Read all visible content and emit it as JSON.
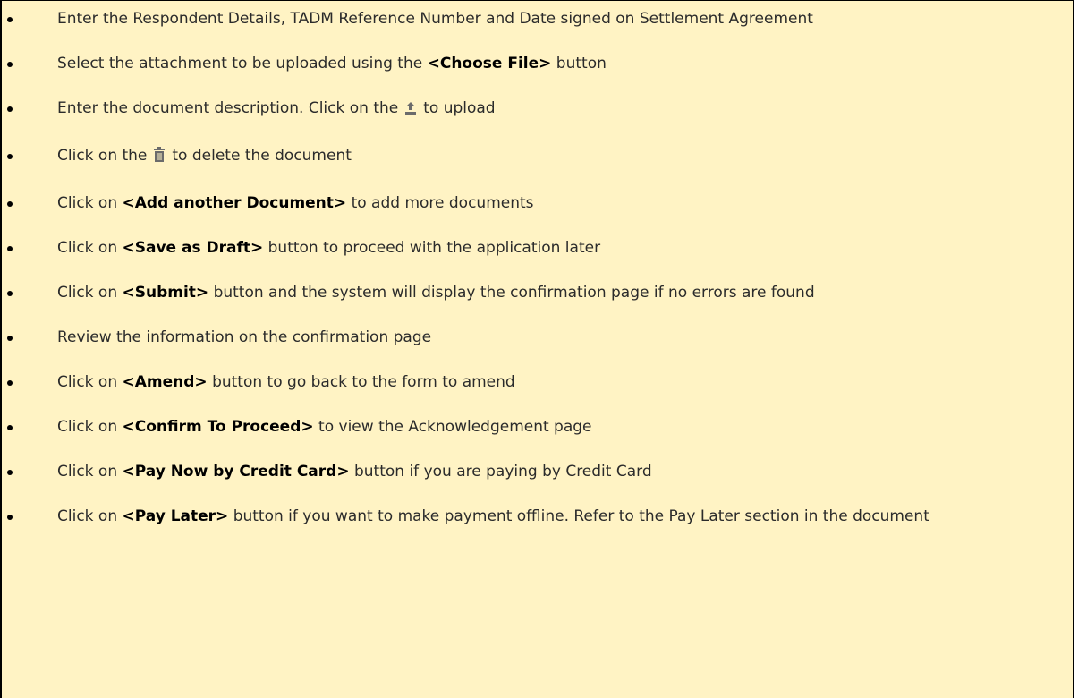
{
  "steps": [
    {
      "pre": "Enter the Respondent Details, TADM Reference Number and Date signed on Settlement Agreement",
      "bold": "",
      "post": ""
    },
    {
      "pre": "Select the attachment to be uploaded using the ",
      "bold": "<Choose File>",
      "post": " button"
    },
    {
      "pre": "Enter the document description. Click on the",
      "icon": "upload-icon",
      "post": "to upload"
    },
    {
      "pre": "Click on the",
      "icon": "trash-icon",
      "post": "to delete the document"
    },
    {
      "pre": "Click on ",
      "bold": "<Add another Document>",
      "post": " to add more documents"
    },
    {
      "pre": "Click on ",
      "bold": "<Save as Draft>",
      "post": " button to proceed with the application later"
    },
    {
      "pre": "Click on ",
      "bold": "<Submit>",
      "post": " button and the system will display the confirmation page if no errors are found"
    },
    {
      "pre": "Review the information on the confirmation page",
      "bold": "",
      "post": ""
    },
    {
      "pre": "Click on ",
      "bold": "<Amend>",
      "post": " button to go back to the form to amend"
    },
    {
      "pre": "Click on ",
      "bold": "<Confirm To Proceed>",
      "post": " to view the Acknowledgement page"
    },
    {
      "pre": "Click on ",
      "bold": "<Pay Now by Credit Card>",
      "post": " button if you are paying by Credit Card"
    },
    {
      "pre": "Click on ",
      "bold": "<Pay Later>",
      "post": " button if you want to make payment offline.  Refer to the Pay Later section in the document"
    }
  ],
  "colors": {
    "background": "#fff3c4",
    "text": "#2b2b2b",
    "icon": "#6b6b6b"
  }
}
